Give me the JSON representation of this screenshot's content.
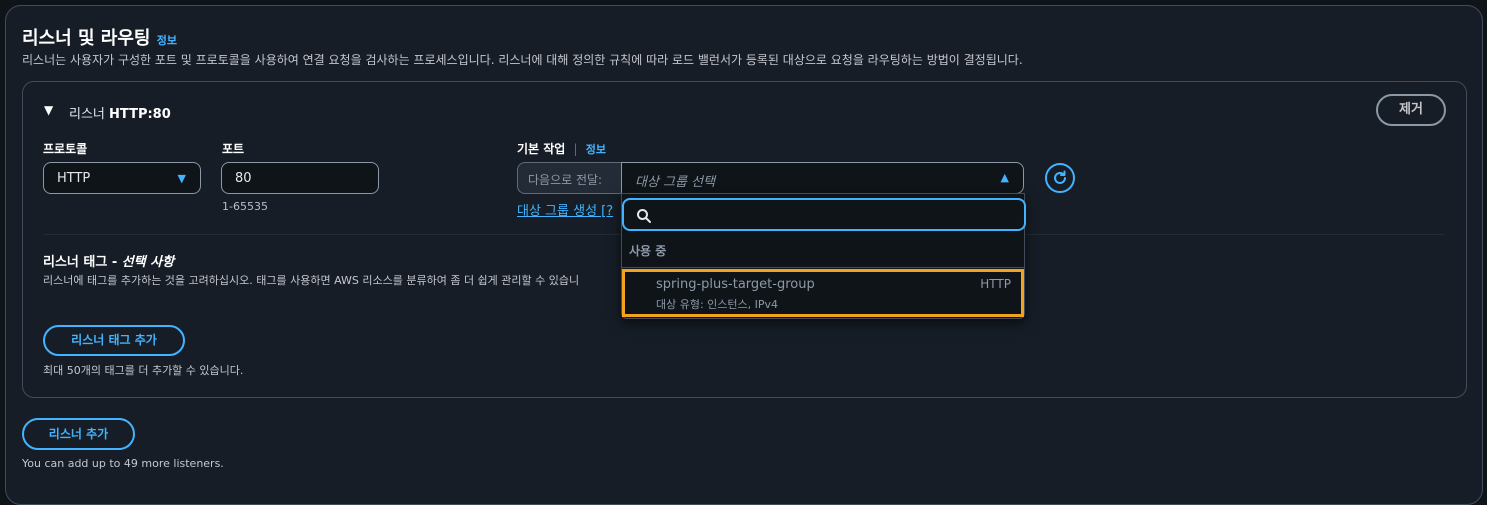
{
  "section": {
    "title": "리스너 및 라우팅",
    "info_label": "정보",
    "description": "리스너는 사용자가 구성한 포트 및 프로토콜을 사용하여 연결 요청을 검사하는 프로세스입니다. 리스너에 대해 정의한 규칙에 따라 로드 밸런서가 등록된 대상으로 요청을 라우팅하는 방법이 결정됩니다."
  },
  "listener": {
    "prefix": "리스너",
    "name": "HTTP:80",
    "remove_label": "제거",
    "protocol": {
      "label": "프로토콜",
      "value": "HTTP"
    },
    "port": {
      "label": "포트",
      "value": "80",
      "hint": "1-65535"
    },
    "default_action": {
      "label": "기본 작업",
      "info_label": "정보",
      "forward_prefix": "다음으로 전달:",
      "target_placeholder": "대상 그룹 선택",
      "create_link": "대상 그룹 생성 [?"
    },
    "dropdown": {
      "search_value": "",
      "group_label": "사용 중",
      "options": [
        {
          "name": "spring-plus-target-group",
          "meta": "대상 유형: 인스턴스, IPv4",
          "protocol": "HTTP"
        }
      ]
    },
    "tags": {
      "title_main": "리스너 태그 - ",
      "title_optional": "선택 사항",
      "description": "리스너에 태그를 추가하는 것을 고려하십시오. 태그를 사용하면 AWS 리소스를 분류하여 좀 더 쉽게 관리할 수 있습니",
      "add_button": "리스너 태그 추가",
      "limit": "최대 50개의 태그를 더 추가할 수 있습니다."
    }
  },
  "add_listener": {
    "button": "리스너 추가",
    "limit": "You can add up to 49 more listeners."
  },
  "colors": {
    "accent": "#42b4ff",
    "highlight": "#f2a21c",
    "background": "#0f1419"
  }
}
